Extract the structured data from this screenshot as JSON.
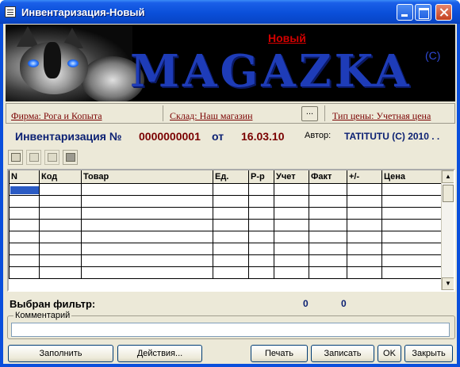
{
  "window": {
    "title": "Инвентаризация-Новый"
  },
  "banner": {
    "badge": "Новый",
    "brand": "MAGAZKA",
    "copyright": "(C)"
  },
  "info": {
    "firm": "Фирма: Рога и Копыта",
    "warehouse": "Склад: Наш магазин",
    "browse": "...",
    "price_type": "Тип цены: Учетная цена"
  },
  "doc": {
    "title": "Инвентаризация №",
    "number": "0000000001",
    "from": "от",
    "date": "16.03.10",
    "author_label": "Автор:",
    "author": "TATITUTU (C) 2010 . ."
  },
  "toolbar": {
    "icons": [
      "add-row-icon",
      "insert-row-icon",
      "delete-row-icon",
      "gray-square-icon"
    ]
  },
  "grid": {
    "columns": [
      "N",
      "Код",
      "Товар",
      "Ед.",
      "Р-р",
      "Учет",
      "Факт",
      "+/-",
      "Цена"
    ],
    "rows": 8
  },
  "footer": {
    "filter_label": "Выбран фильтр:",
    "count1": "0",
    "count2": "0",
    "comment_label": "Комментарий",
    "comment_value": ""
  },
  "buttons": {
    "fill": "Заполнить",
    "actions": "Действия...",
    "print": "Печать",
    "save": "Записать",
    "ok": "OK",
    "close": "Закрыть"
  },
  "colors": {
    "titlebar": "#0a4fdc",
    "brand": "#1e3cb8",
    "doc_number": "#7a0000",
    "header_text": "#0a1f72",
    "selection": "#2b5bc4"
  }
}
